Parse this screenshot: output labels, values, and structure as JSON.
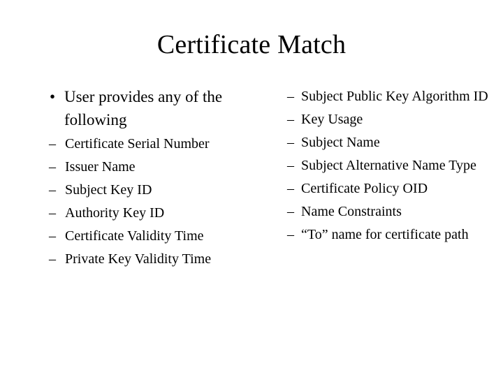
{
  "slide": {
    "title": "Certificate Match",
    "background_color": "#ffffff",
    "text_color": "#000000",
    "bullet_marker_level1": "•",
    "bullet_marker_level2": "–",
    "left_column": {
      "level1": {
        "text": "User provides any of the following",
        "sub_items": [
          "Certificate Serial Number",
          "Issuer Name",
          "Subject Key ID",
          "Authority Key ID",
          "Certificate Validity Time",
          "Private Key Validity Time"
        ]
      }
    },
    "right_column": {
      "items": [
        "Subject Public Key Algorithm ID",
        "Key Usage",
        "Subject Name",
        "Subject Alternative Name Type",
        "Certificate Policy OID",
        "Name Constraints",
        "“To” name for certificate path"
      ]
    }
  }
}
